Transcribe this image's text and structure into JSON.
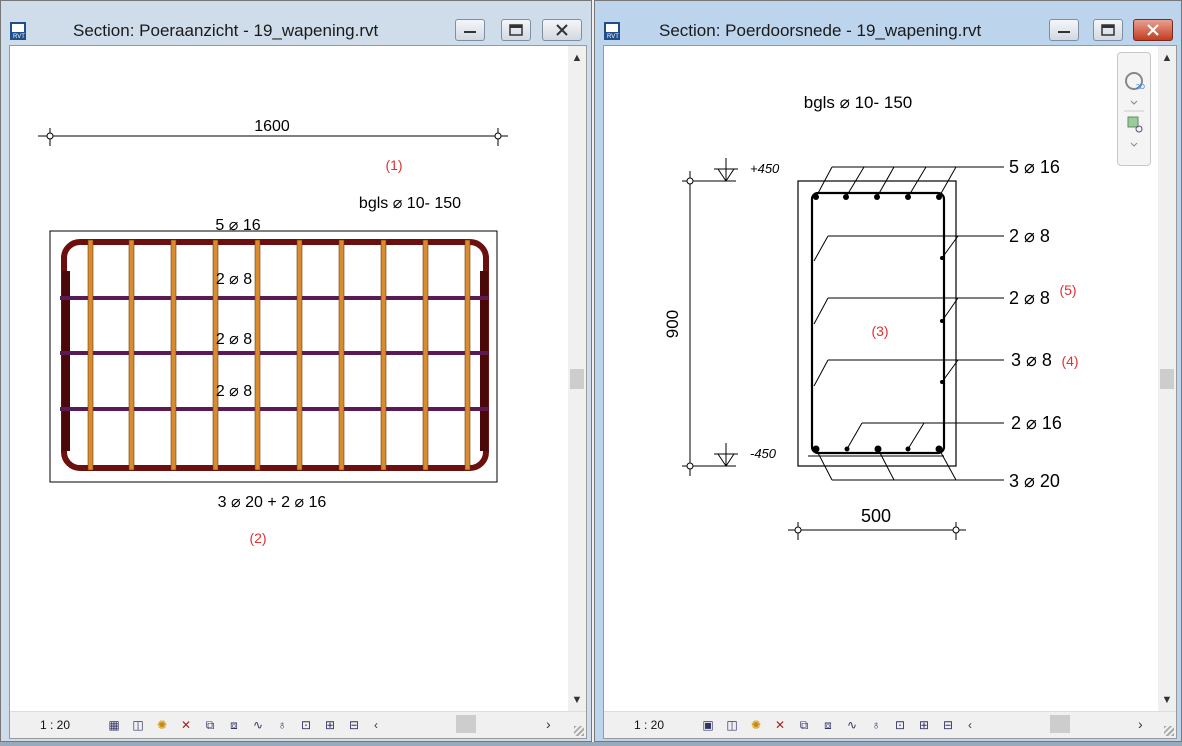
{
  "left_window": {
    "title": "Section: Poeraanzicht - 19_wapening.rvt",
    "scale": "1 : 20",
    "drawing": {
      "dim_width": "1600",
      "stirrup_label": "bgls ⌀ 10- 150",
      "top_label": "5 ⌀ 16",
      "mid_labels": [
        "2 ⌀ 8",
        "2 ⌀ 8",
        "2 ⌀ 8"
      ],
      "bottom_label": "3 ⌀ 20 + 2 ⌀ 16",
      "callouts": [
        "(1)",
        "(2)"
      ]
    }
  },
  "right_window": {
    "title": "Section: Poerdoorsnede - 19_wapening.rvt",
    "scale": "1 : 20",
    "drawing": {
      "stirrup_label": "bgls ⌀ 10- 150",
      "level_top": "+450",
      "level_bottom": "-450",
      "dim_height": "900",
      "dim_width": "500",
      "right_labels": [
        "5 ⌀ 16",
        "2 ⌀ 8",
        "2 ⌀ 8",
        "3 ⌀ 8",
        "2 ⌀ 16",
        "3 ⌀ 20"
      ],
      "callouts": [
        "(3)",
        "(4)",
        "(5)"
      ]
    }
  },
  "status_icons": [
    "detail-level-icon",
    "visual-style-icon",
    "sun-path-icon",
    "shadows-icon",
    "crop-view-icon",
    "show-crop-icon",
    "temporary-hide-icon",
    "reveal-hidden-icon",
    "worksharing-icon",
    "analytical-icon",
    "highlight-displacement-icon",
    "reveal-constraints-icon"
  ],
  "colors": {
    "rebar_main": "#6b0f0f",
    "rebar_stirrup": "#d98b2e",
    "rebar_secondary": "#5a1a55",
    "callout": "#e03030"
  }
}
